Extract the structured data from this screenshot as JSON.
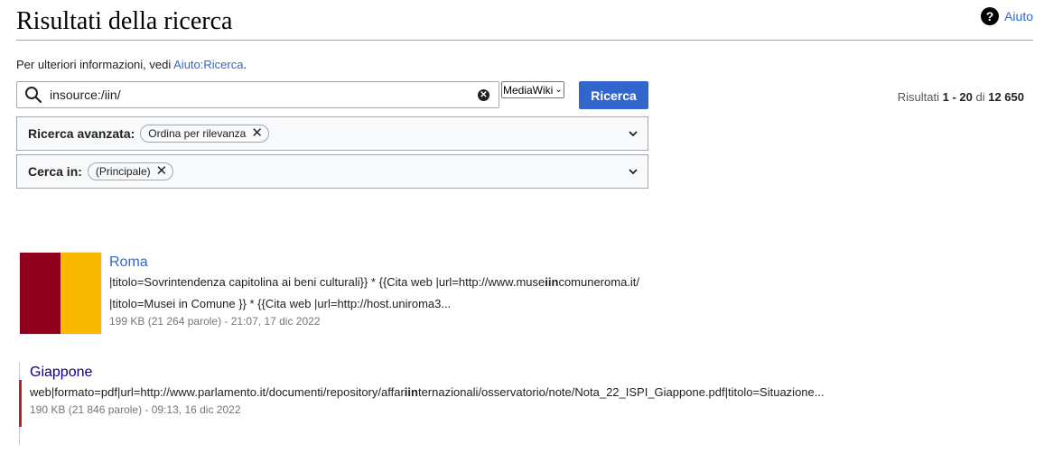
{
  "header": {
    "title": "Risultati della ricerca",
    "help_label": "Aiuto",
    "help_icon": "?"
  },
  "info": {
    "prefix": "Per ulteriori informazioni, vedi ",
    "link": "Aiuto:Ricerca",
    "suffix": "."
  },
  "search": {
    "value": "insource:/iin/",
    "profile": "MediaWiki",
    "button_label": "Ricerca"
  },
  "results_count": {
    "prefix": "Risultati ",
    "range": "1 - 20",
    "of": " di ",
    "total": "12 650"
  },
  "advanced": {
    "label": "Ricerca avanzata:",
    "chip": "Ordina per rilevanza"
  },
  "search_in": {
    "label": "Cerca in:",
    "chip": "(Principale)"
  },
  "results": [
    {
      "title": "Roma",
      "line1_pre": "|titolo=Sovrintendenza capitolina ai beni culturali}} * {{Cita web |url=http://www.muse",
      "line1_match": "iin",
      "line1_post": "comuneroma.it/",
      "line2": "|titolo=Musei in Comune }} * {{Cita web |url=http://host.uniroma3...",
      "meta": "199 KB (21 264 parole) - 21:07, 17 dic 2022",
      "flag_colors": [
        "#8e001c",
        "#fbb800"
      ]
    },
    {
      "title": "Giappone",
      "line1_pre": "web|formato=pdf|url=http://www.parlamento.it/documenti/repository/affar",
      "line1_match": "iin",
      "line1_post": "ternazionali/osservatorio/note/Nota_22_ISPI_Giappone.pdf|titolo=Situazione...",
      "meta": "190 KB (21 846 parole) - 09:13, 16 dic 2022"
    }
  ],
  "colors": {
    "accent": "#3366cc",
    "visited_link": "#0b0080",
    "border": "#a2a9b1"
  }
}
